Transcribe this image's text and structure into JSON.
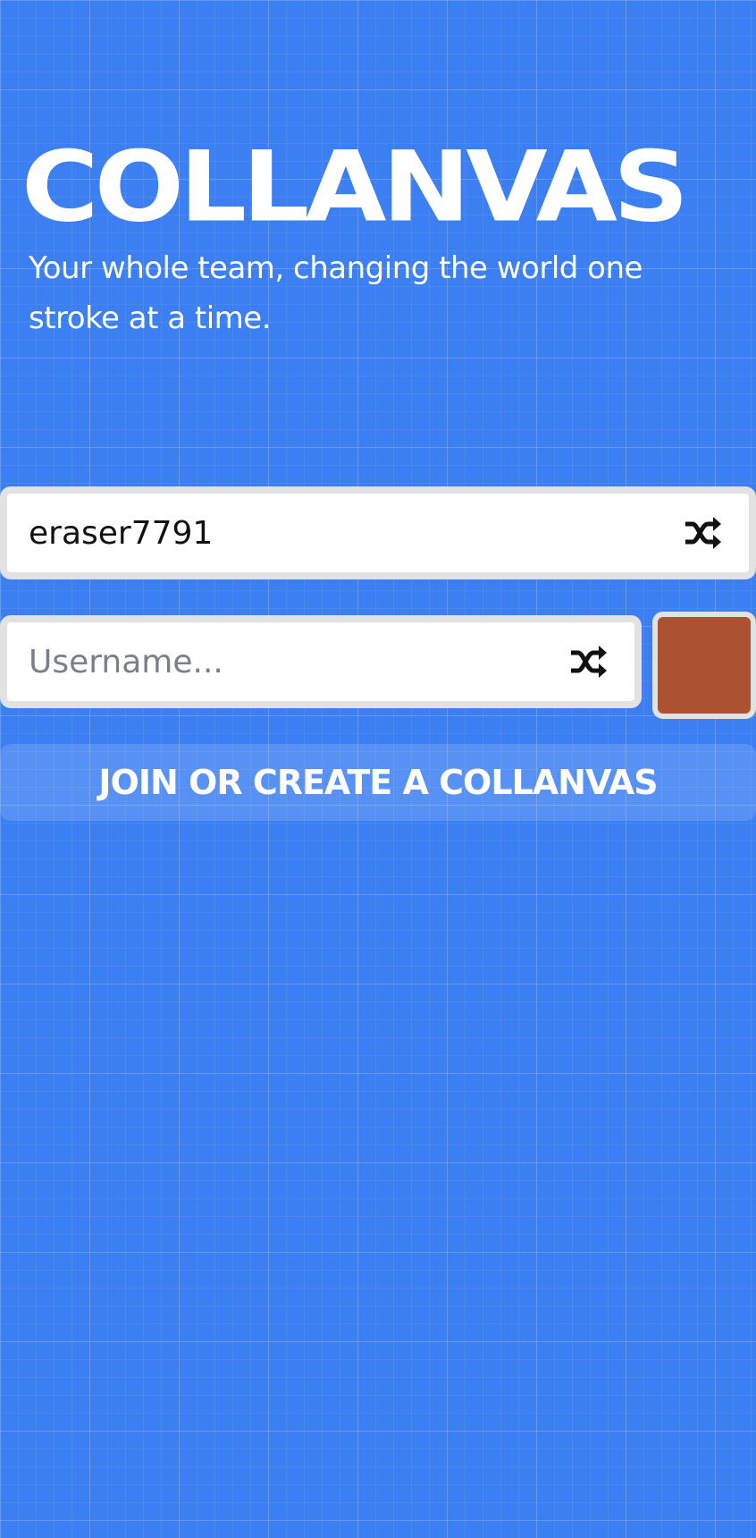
{
  "hero": {
    "title": "COLLANVAS",
    "subtitle": "Your whole team, changing the world one stroke at a time."
  },
  "room_field": {
    "value": "eraser7791",
    "icon": "shuffle-icon"
  },
  "username_field": {
    "value": "",
    "placeholder": "Username...",
    "icon": "shuffle-icon"
  },
  "color_picker": {
    "selected_color": "#ad5230"
  },
  "join_button": {
    "label": "JOIN OR CREATE A COLLANVAS"
  },
  "colors": {
    "background": "#3b7ff2",
    "field_border": "#e2e2e2",
    "text": "#111111"
  }
}
